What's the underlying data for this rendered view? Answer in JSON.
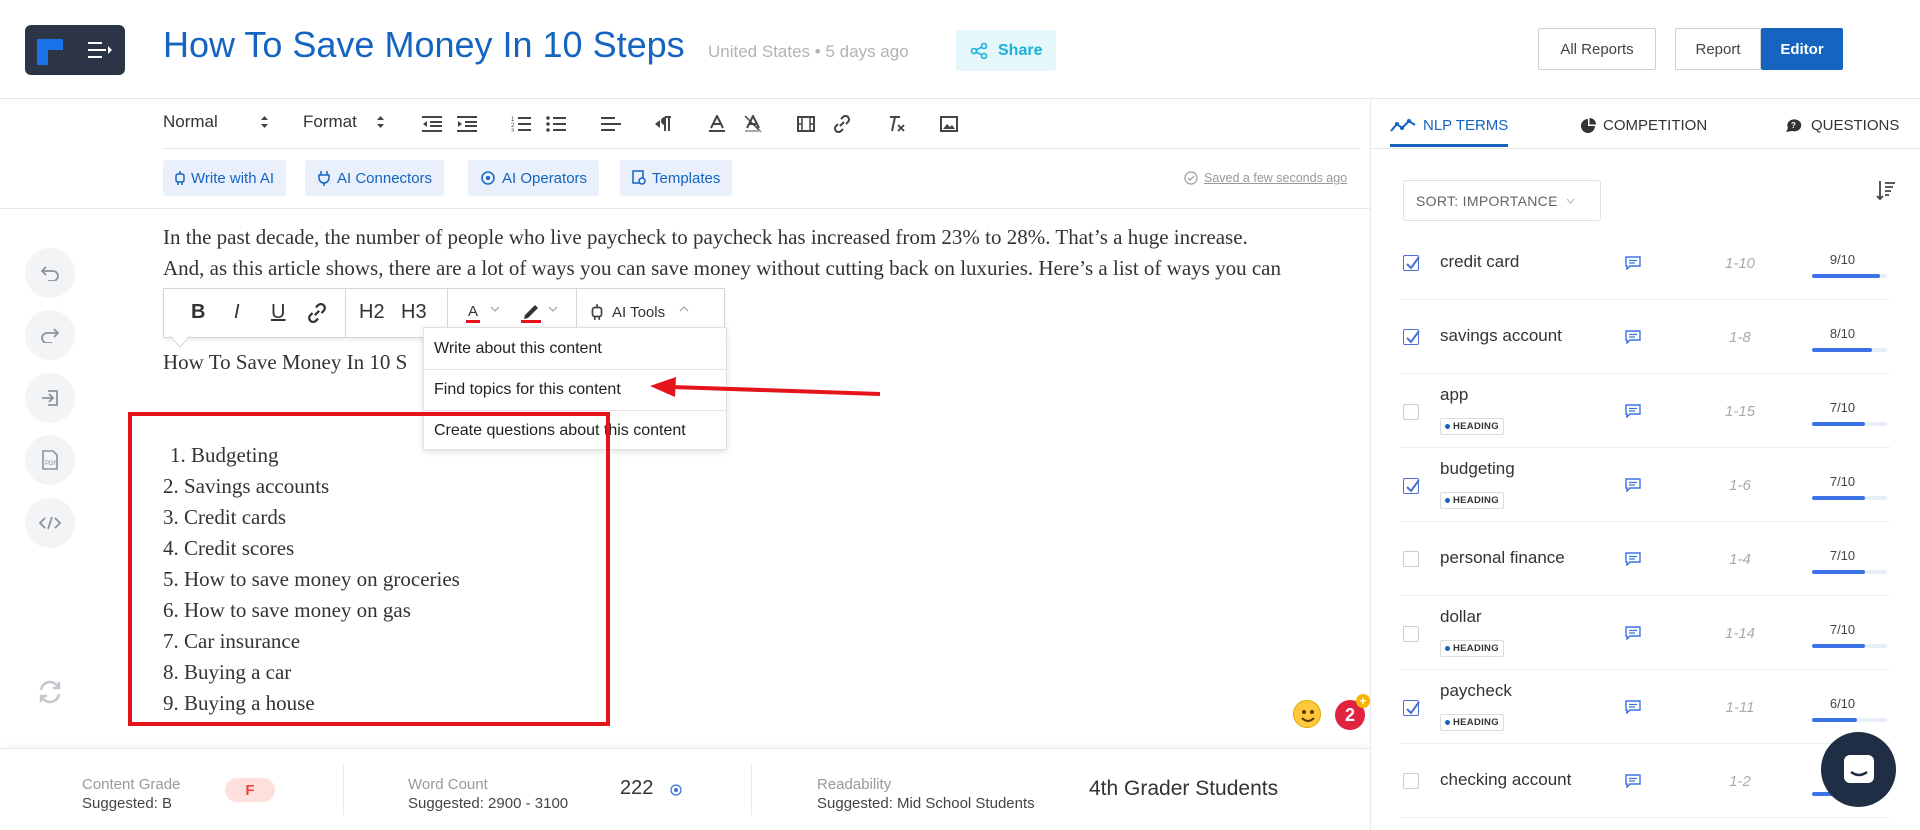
{
  "header": {
    "title": "How To Save Money In 10 Steps",
    "location": "United States",
    "separator": "•",
    "time": "5 days ago",
    "share_label": "Share",
    "all_reports_label": "All Reports",
    "report_label": "Report",
    "editor_label": "Editor"
  },
  "toolbar": {
    "block_style": "Normal",
    "format": "Format",
    "ai_buttons": [
      "Write with AI",
      "AI Connectors",
      "AI Operators",
      "Templates"
    ],
    "saved_status": "Saved a few seconds ago"
  },
  "editor": {
    "paragraph1": "In the past decade, the number of people who live paycheck to paycheck has increased from 23% to 28%. That’s a huge increase.",
    "paragraph2": "And, as this article shows, there are a lot of ways you can save money without cutting back on luxuries. Here’s a list of ways you can",
    "paragraph3": "How To Save Money In 10 S",
    "list": [
      "1. Budgeting",
      "2. Savings accounts",
      "3. Credit cards",
      "4. Credit scores",
      "5. How to save money on groceries",
      "6. How to save money on gas",
      "7. Car insurance",
      "8. Buying a car",
      "9. Buying a house"
    ]
  },
  "format_bar": {
    "bold": "B",
    "italic": "I",
    "underline": "U",
    "h2": "H2",
    "h3": "H3",
    "text_color_glyph": "A",
    "ai_tools": "AI Tools"
  },
  "ai_menu": {
    "items": [
      "Write about this content",
      "Find topics for this content",
      "Create questions about this content"
    ]
  },
  "badge": {
    "count": "2",
    "plus": "+"
  },
  "bottom": {
    "content_grade_label": "Content Grade",
    "content_grade_suggested": "Suggested: B",
    "content_grade": "F",
    "word_count_label": "Word Count",
    "word_count_suggested": "Suggested: 2900 - 3100",
    "word_count": "222",
    "readability_label": "Readability",
    "readability_suggested": "Suggested: Mid School Students",
    "readability": "4th Grader Students"
  },
  "panel": {
    "tabs": [
      "NLP TERMS",
      "COMPETITION",
      "QUESTIONS"
    ],
    "sort_label": "SORT: IMPORTANCE",
    "heading_tag": "HEADING",
    "terms": [
      {
        "term": "credit card",
        "checked": true,
        "heading": false,
        "range": "1-10",
        "score": "9/10",
        "fill": 0.9
      },
      {
        "term": "savings account",
        "checked": true,
        "heading": false,
        "range": "1-8",
        "score": "8/10",
        "fill": 0.8
      },
      {
        "term": "app",
        "checked": false,
        "heading": true,
        "range": "1-15",
        "score": "7/10",
        "fill": 0.7
      },
      {
        "term": "budgeting",
        "checked": true,
        "heading": true,
        "range": "1-6",
        "score": "7/10",
        "fill": 0.7
      },
      {
        "term": "personal finance",
        "checked": false,
        "heading": false,
        "range": "1-4",
        "score": "7/10",
        "fill": 0.7
      },
      {
        "term": "dollar",
        "checked": false,
        "heading": true,
        "range": "1-14",
        "score": "7/10",
        "fill": 0.7
      },
      {
        "term": "paycheck",
        "checked": true,
        "heading": true,
        "range": "1-11",
        "score": "6/10",
        "fill": 0.6
      },
      {
        "term": "checking account",
        "checked": false,
        "heading": false,
        "range": "1-2",
        "score": "",
        "fill": 0.6
      }
    ]
  },
  "colors": {
    "accent": "#1565c0",
    "annotation": "#e5141b",
    "grade_bad": "#e5483a"
  }
}
